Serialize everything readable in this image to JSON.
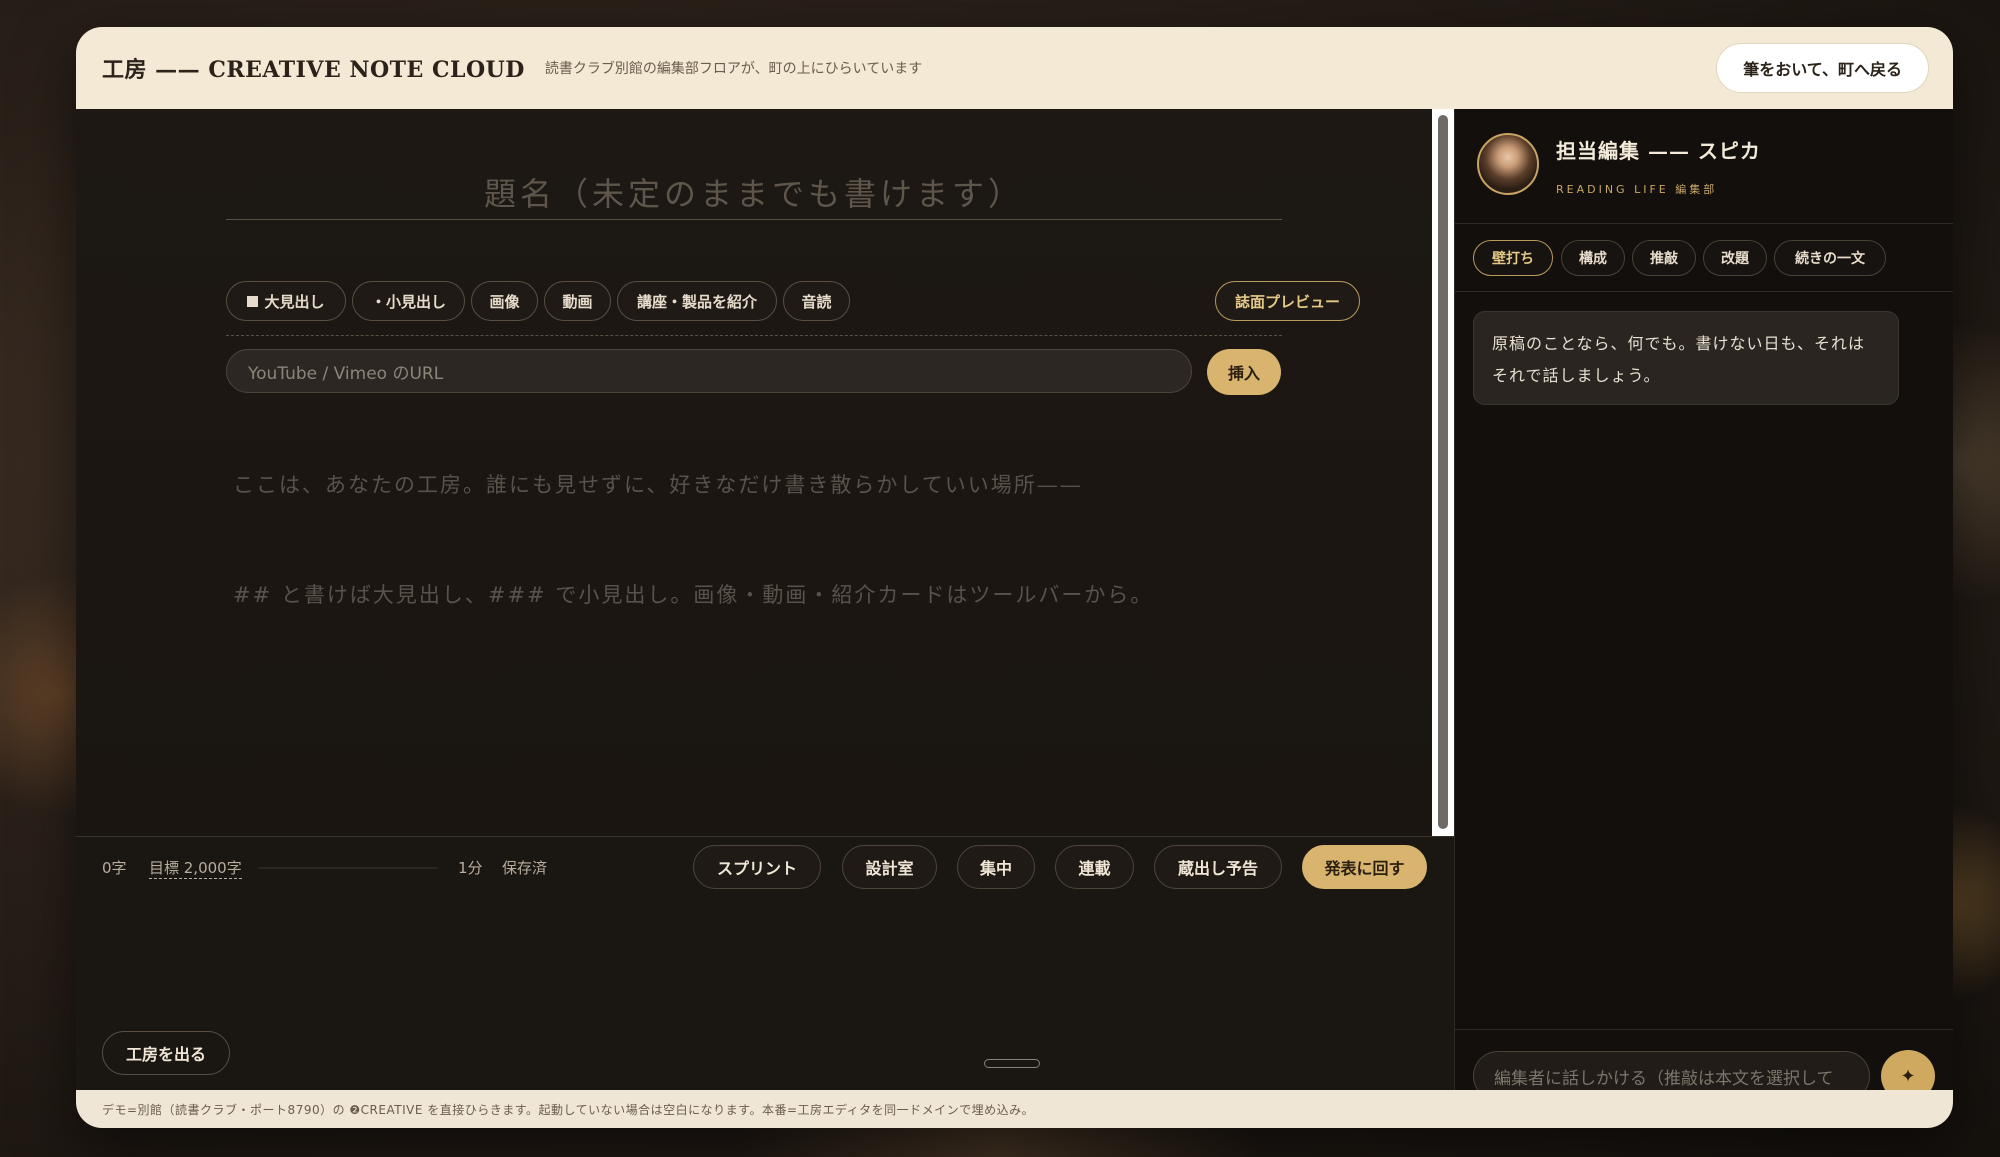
{
  "header": {
    "brand": "工房 —— CREATIVE NOTE CLOUD",
    "subtitle": "読書クラブ別館の編集部フロアが、町の上にひらいています",
    "back_button": "筆をおいて、町へ戻る"
  },
  "editor": {
    "title_placeholder": "題名（未定のままでも書けます）",
    "toolbar": {
      "heading_large": "大見出し",
      "heading_small": "・小見出し",
      "image": "画像",
      "video": "動画",
      "product": "講座・製品を紹介",
      "read_aloud": "音読",
      "preview": "誌面プレビュー"
    },
    "url_placeholder": "YouTube / Vimeo のURL",
    "insert_button": "挿入",
    "body_line1": "ここは、あなたの工房。誰にも見せずに、好きなだけ書き散らかしていい場所——",
    "body_line2": "## と書けば大見出し、### で小見出し。画像・動画・紹介カードはツールバーから。"
  },
  "status": {
    "char_count": "0字",
    "goal": "目標 2,000字",
    "progress": 0,
    "time": "1分",
    "saved": "保存済",
    "modes": {
      "sprint": "スプリント",
      "design": "設計室",
      "focus": "集中",
      "serial": "連載",
      "preview_release": "蔵出し予告",
      "publish": "発表に回す"
    },
    "exit_button": "工房を出る"
  },
  "sidebar": {
    "editor_name": "担当編集 —— スピカ",
    "editor_dept": "READING LIFE 編集部",
    "tabs": [
      "壁打ち",
      "構成",
      "推敲",
      "改題",
      "続きの一文"
    ],
    "active_tab": 0,
    "message": "原稿のことなら、何でも。書けない日も、それはそれで話しましょう。",
    "chat_placeholder": "編集者に話しかける（推敲は本文を選択して",
    "send_icon": "✦"
  },
  "footer": {
    "text": "デモ=別館（読書クラブ・ポート8790）の ❷CREATIVE を直接ひらきます。起動していない場合は空白になります。本番=工房エディタを同一ドメインで埋め込み。"
  },
  "colors": {
    "accent_gold": "#d8b46f",
    "header_bg": "#f3e9d4",
    "editor_bg": "#1b1713"
  }
}
